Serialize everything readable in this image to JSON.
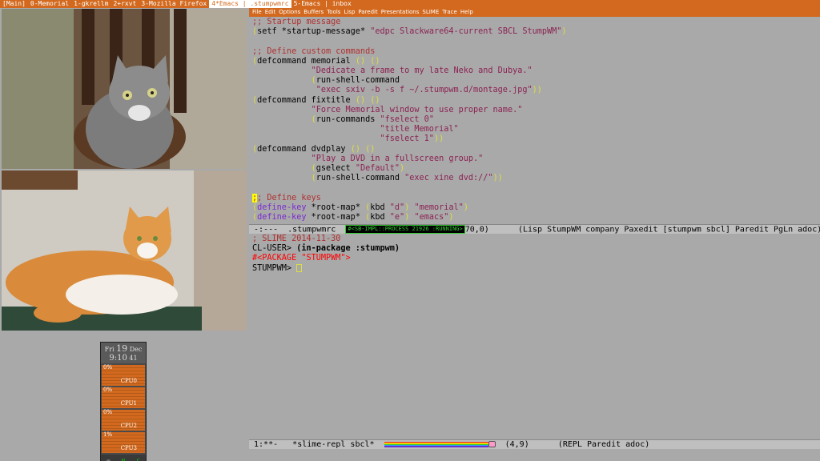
{
  "topbar": {
    "windows": [
      {
        "label": "[Main]",
        "active": false
      },
      {
        "label": "0-Memorial",
        "active": false
      },
      {
        "label": "1-gkrellm",
        "active": false
      },
      {
        "label": "2+rxvt",
        "active": false
      },
      {
        "label": "3-Mozilla Firefox",
        "active": false
      },
      {
        "label": "4*Emacs | .stumpwmrc",
        "active": true
      },
      {
        "label": "5-Emacs | inbox",
        "active": false
      }
    ]
  },
  "gkrellm": {
    "day": "Fri",
    "date": "19",
    "month": "Dec",
    "time": "9:10",
    "seconds": "41",
    "cpus": [
      {
        "label": "CPU0",
        "pct": "0%"
      },
      {
        "label": "CPU1",
        "pct": "0%"
      },
      {
        "label": "CPU2",
        "pct": "0%"
      },
      {
        "label": "CPU3",
        "pct": "1%"
      }
    ],
    "footer_left": "N",
    "footer_right": "C"
  },
  "emacs": {
    "menu": [
      "File",
      "Edit",
      "Options",
      "Buffers",
      "Tools",
      "Lisp",
      "Paredit",
      "Presentations",
      "SLIME",
      "Trace",
      "Help"
    ],
    "modeline1": {
      "status": " -:---  .stumpwmrc  ",
      "process": "#<SB-IMPL::PROCESS 21926 :RUNNING>",
      "rest": "70,0)      (Lisp StumpWM company Paxedit [stumpwm sbcl] Paredit PgLn adoc)"
    },
    "repl": {
      "line1": "; SLIME 2014-11-30",
      "line2_prompt": "CL-USER> ",
      "line2_form": "(in-package :stumpwm)",
      "line3": "#<PACKAGE \"STUMPWM\">",
      "line4_prompt": "STUMPWM> "
    },
    "modeline2": {
      "left": " 1:**-   *slime-repl sbcl*  ",
      "right": "  (4,9)      (REPL Paredit adoc)"
    }
  },
  "colors": {
    "accent": "#d2691e",
    "background": "#a9a9a9",
    "comment": "#b03030",
    "string": "#8b2252",
    "paren": "#dddd40",
    "keyword": "#7a2ad0"
  }
}
